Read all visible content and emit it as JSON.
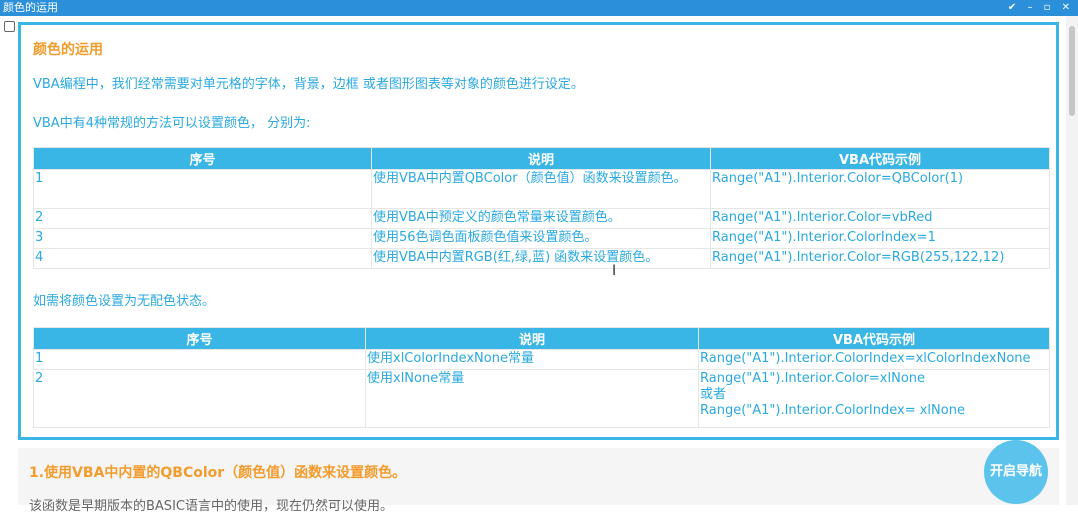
{
  "window": {
    "title": "颜色的运用",
    "controls": "✔ – ▫ ✕"
  },
  "panel": {
    "heading": "颜色的运用",
    "intro": "VBA编程中，我们经常需要对单元格的字体，背景，边框 或者图形图表等对象的颜色进行设定。",
    "methods_intro": "VBA中有4种常规的方法可以设置颜色， 分别为:",
    "table1": {
      "headers": [
        "序号",
        "说明",
        "VBA代码示例"
      ],
      "rows": [
        [
          "1",
          "使用VBA中内置QBColor（颜色值）函数来设置颜色。",
          "Range(\"A1\").Interior.Color=QBColor(1)"
        ],
        [
          "2",
          "使用VBA中预定义的颜色常量来设置颜色。",
          "Range(\"A1\").Interior.Color=vbRed"
        ],
        [
          "3",
          "使用56色调色面板颜色值来设置颜色。",
          "Range(\"A1\").Interior.ColorIndex=1"
        ],
        [
          "4",
          "使用VBA中内置RGB(红,绿,蓝) 函数来设置颜色。",
          "Range(\"A1\").Interior.Color=RGB(255,122,12)"
        ]
      ]
    },
    "none_intro": "如需将颜色设置为无配色状态。",
    "table2": {
      "headers": [
        "序号",
        "说明",
        "VBA代码示例"
      ],
      "rows": [
        [
          "1",
          "使用xlColorIndexNone常量",
          "Range(\"A1\").Interior.ColorIndex=xlColorIndexNone"
        ],
        [
          "2",
          "使用xlNone常量",
          "Range(\"A1\").Interior.Color=xlNone",
          "或者",
          "Range(\"A1\").Interior.ColorIndex= xlNone"
        ]
      ]
    }
  },
  "section": {
    "heading": "1.使用VBA中内置的QBColor（颜色值）函数来设置颜色。",
    "text": "该函数是早期版本的BASIC语言中的使用，现在仍然可以使用。"
  },
  "nav_button": "开启导航",
  "colors": {
    "titlebar": "#2b8fd9",
    "accent": "#39b6e5",
    "text_blue": "#2aa9e0",
    "heading_orange": "#f39c2e"
  }
}
